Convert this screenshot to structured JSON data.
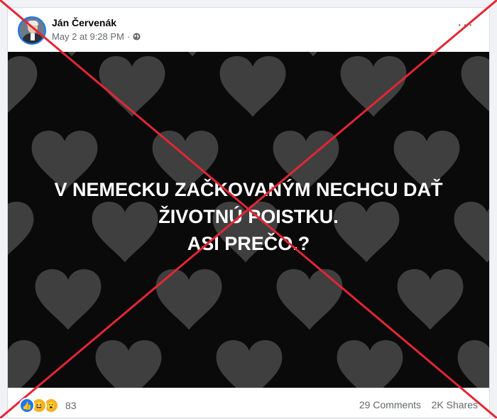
{
  "post": {
    "author": "Ján Červenák",
    "timestamp": "May 2 at 9:28 PM",
    "privacy_icon": "globe-icon",
    "more_label": "···"
  },
  "image": {
    "line1": "V NEMECKU ZAČKOVANÝM NECHCU DAŤ",
    "line2": "ŽIVOTNÚ POISTKU.",
    "line3": "ASI PREČO.?",
    "background": "black with grey hearts pattern"
  },
  "footer": {
    "reactions": [
      "like-icon",
      "haha-icon",
      "wow-icon"
    ],
    "reaction_count": "83",
    "comments": "29 Comments",
    "shares": "2K Shares"
  },
  "overlay": {
    "cross_color": "#e32636"
  }
}
